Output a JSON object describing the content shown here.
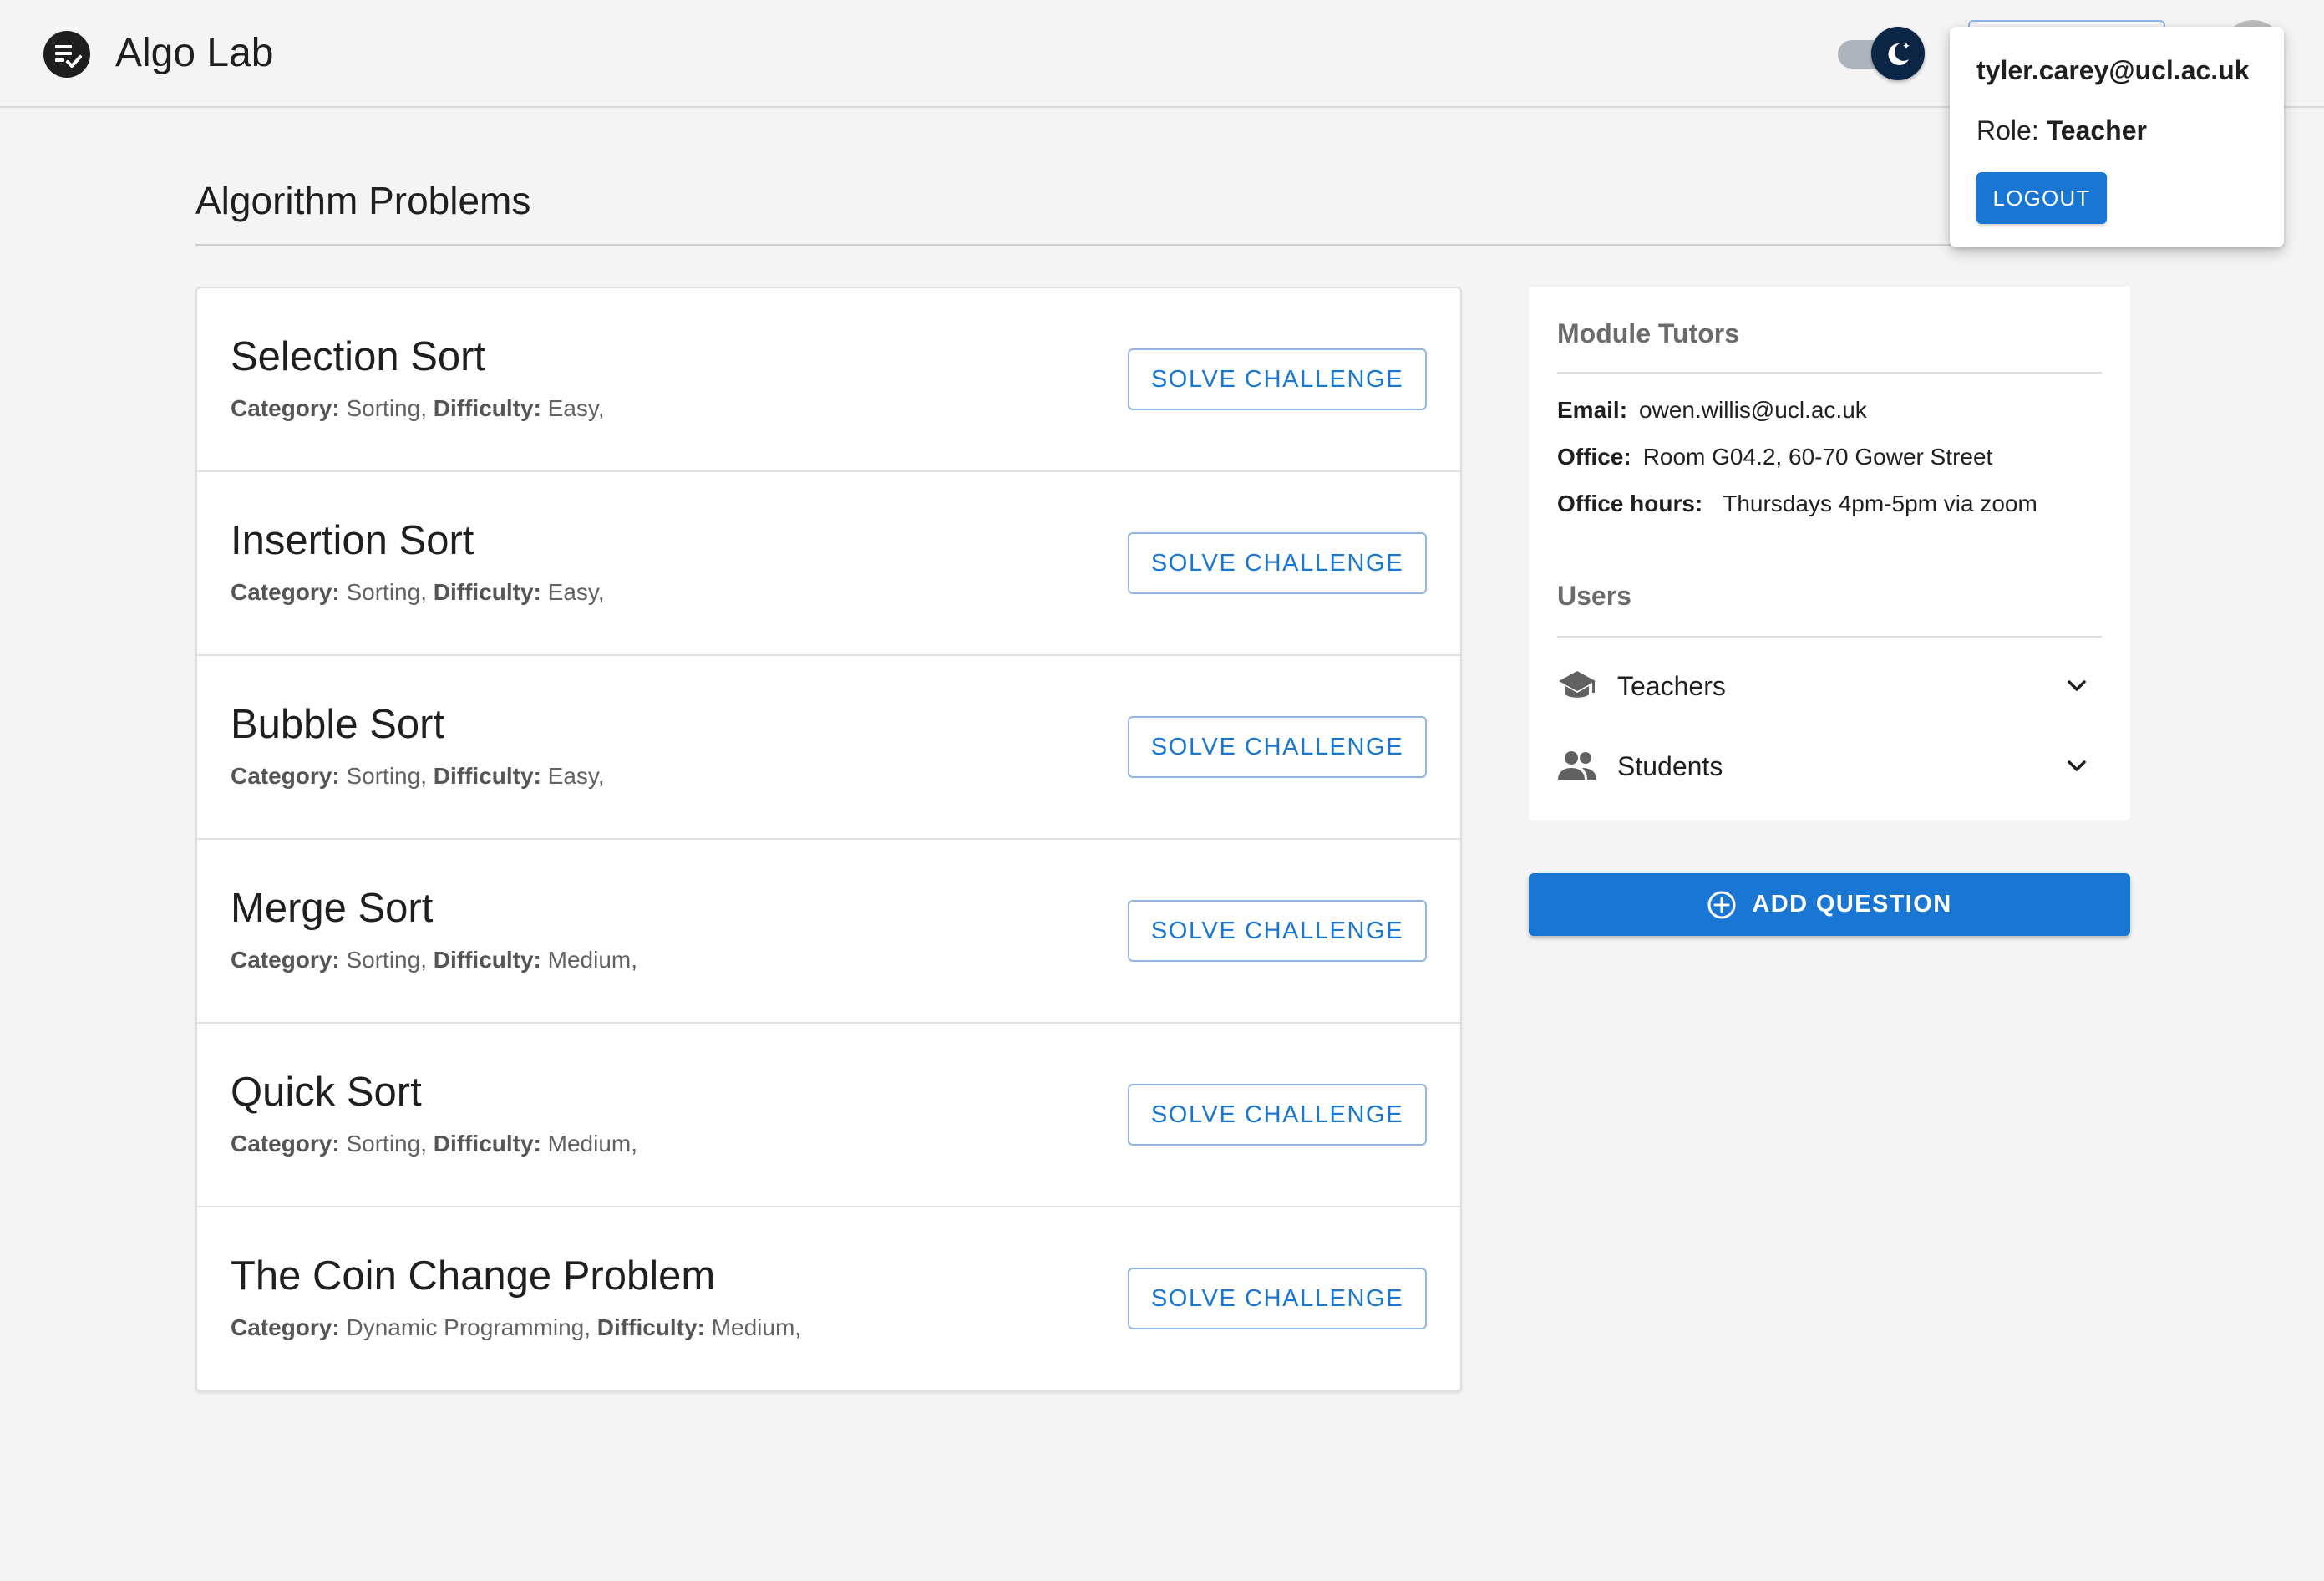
{
  "app": {
    "title": "Algo Lab"
  },
  "page": {
    "title": "Algorithm Problems"
  },
  "labels": {
    "category": "Category:",
    "difficulty": "Difficulty:"
  },
  "problems": [
    {
      "name": "Selection Sort",
      "category": "Sorting",
      "difficulty": "Easy",
      "action": "SOLVE CHALLENGE"
    },
    {
      "name": "Insertion Sort",
      "category": "Sorting",
      "difficulty": "Easy",
      "action": "SOLVE CHALLENGE"
    },
    {
      "name": "Bubble Sort",
      "category": "Sorting",
      "difficulty": "Easy",
      "action": "SOLVE CHALLENGE"
    },
    {
      "name": "Merge Sort",
      "category": "Sorting",
      "difficulty": "Medium",
      "action": "SOLVE CHALLENGE"
    },
    {
      "name": "Quick Sort",
      "category": "Sorting",
      "difficulty": "Medium",
      "action": "SOLVE CHALLENGE"
    },
    {
      "name": "The Coin Change Problem",
      "category": "Dynamic Programming",
      "difficulty": "Medium",
      "action": "SOLVE CHALLENGE"
    }
  ],
  "tutors": {
    "title": "Module Tutors",
    "email_label": "Email:",
    "email": "owen.willis@ucl.ac.uk",
    "office_label": "Office:",
    "office": "Room G04.2, 60-70 Gower Street",
    "hours_label": "Office hours:",
    "hours": "Thursdays 4pm-5pm via zoom"
  },
  "users": {
    "title": "Users",
    "groups": [
      {
        "label": "Teachers",
        "icon": "school-icon"
      },
      {
        "label": "Students",
        "icon": "people-icon"
      }
    ]
  },
  "actions": {
    "add_question": "ADD QUESTION"
  },
  "profile": {
    "email": "tyler.carey@ucl.ac.uk",
    "role_label": "Role:",
    "role": "Teacher",
    "logout": "LOGOUT"
  },
  "colors": {
    "primary": "#1976d2",
    "background": "#f4f4f4",
    "toggle_thumb": "#0b2545"
  }
}
